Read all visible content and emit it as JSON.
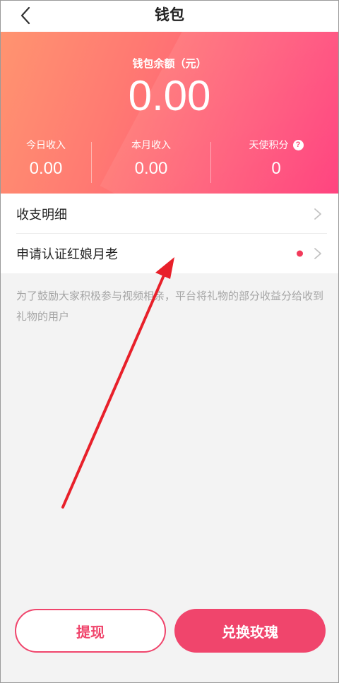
{
  "navbar": {
    "title": "钱包"
  },
  "wallet": {
    "balance_label": "钱包余额（元）",
    "balance_value": "0.00",
    "stats": [
      {
        "label": "今日收入",
        "value": "0.00"
      },
      {
        "label": "本月收入",
        "value": "0.00"
      },
      {
        "label": "天使积分",
        "value": "0",
        "help_icon": "?"
      }
    ]
  },
  "menu": {
    "items": [
      {
        "label": "收支明细"
      },
      {
        "label": "申请认证红娘月老",
        "badge": "red-dot"
      }
    ]
  },
  "notice": "为了鼓励大家积极参与视频相亲，平台将礼物的部分收益分给收到礼物的用户",
  "actions": {
    "withdraw": "提现",
    "exchange": "兑换玫瑰"
  },
  "colors": {
    "accent": "#f0456c",
    "banner_start": "#ff9470",
    "banner_end": "#ff3e7c",
    "annotation_arrow": "#e8202a"
  }
}
